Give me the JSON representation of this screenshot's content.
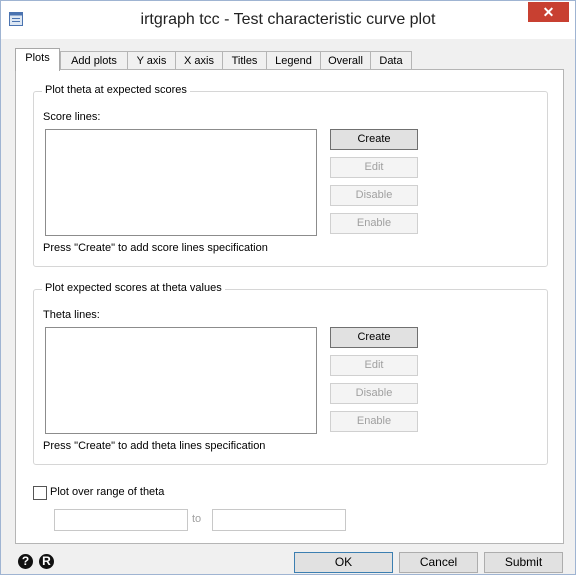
{
  "window": {
    "title": "irtgraph tcc - Test characteristic curve plot",
    "close_glyph": "✕"
  },
  "tabs": [
    "Plots",
    "Add plots",
    "Y axis",
    "X axis",
    "Titles",
    "Legend",
    "Overall",
    "Data"
  ],
  "score_group": {
    "legend": "Plot theta at expected scores",
    "list_label": "Score lines:",
    "hint": "Press \"Create\" to add score lines specification",
    "buttons": {
      "create": "Create",
      "edit": "Edit",
      "disable": "Disable",
      "enable": "Enable"
    }
  },
  "theta_group": {
    "legend": "Plot expected scores at theta values",
    "list_label": "Theta lines:",
    "hint": "Press \"Create\" to add theta lines specification",
    "buttons": {
      "create": "Create",
      "edit": "Edit",
      "disable": "Disable",
      "enable": "Enable"
    }
  },
  "range": {
    "checkbox_label": "Plot over range of theta",
    "checked": false,
    "to_label": "to",
    "from_value": "",
    "to_value": ""
  },
  "footer": {
    "help_icon": "?",
    "reset_icon": "R",
    "ok": "OK",
    "cancel": "Cancel",
    "submit": "Submit"
  },
  "colors": {
    "close_button": "#c84031",
    "disabled_text": "#a0a0a0"
  },
  "icons": {
    "app": "dialog-app-icon",
    "help": "help-icon",
    "reset": "reset-icon",
    "close": "close-icon"
  }
}
